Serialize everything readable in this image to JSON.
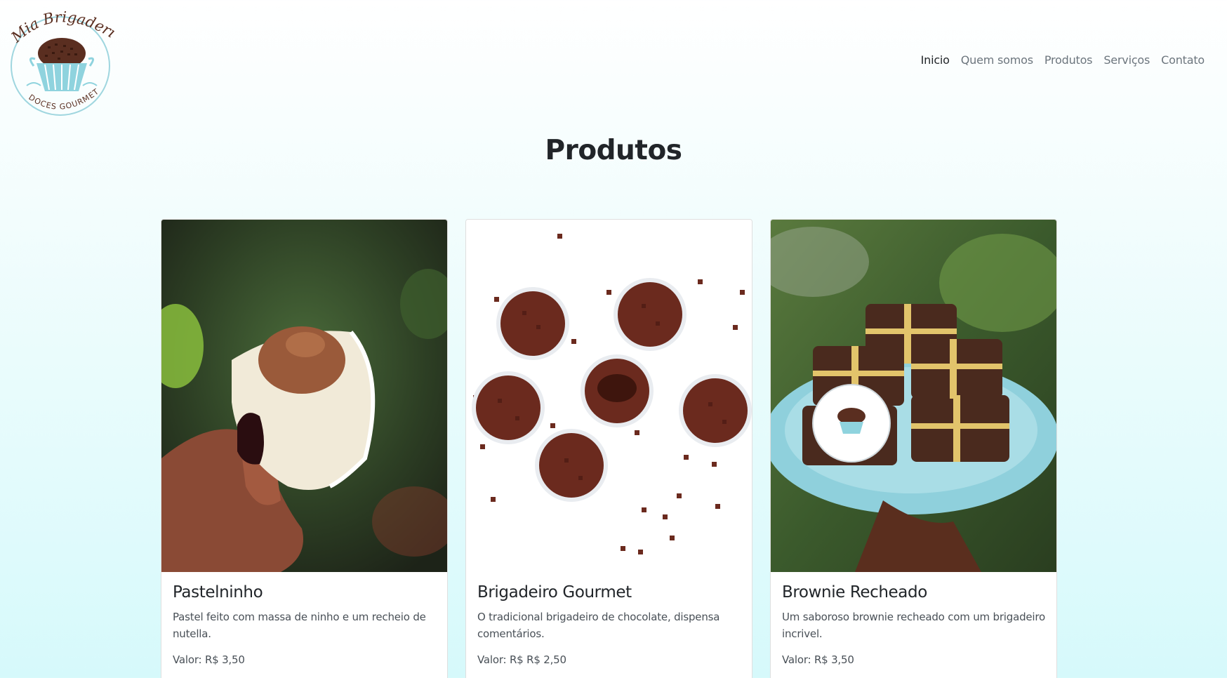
{
  "logo": {
    "script_text": "Mia Brigaderia",
    "tagline": "DOCES GOURMET"
  },
  "nav": {
    "items": [
      {
        "label": "Inicio"
      },
      {
        "label": "Quem somos"
      },
      {
        "label": "Produtos"
      },
      {
        "label": "Serviços"
      },
      {
        "label": "Contato"
      }
    ]
  },
  "page": {
    "title": "Produtos"
  },
  "products": [
    {
      "title": "Pastelninho",
      "description": "Pastel feito com massa de ninho e um recheio de nutella.",
      "price": "Valor: R$ 3,50",
      "image": "pastel-photo"
    },
    {
      "title": "Brigadeiro Gourmet",
      "description": "O tradicional brigadeiro de chocolate, dispensa comentários.",
      "price": "Valor: R$ R$ 2,50",
      "image": "brigadeiro-photo"
    },
    {
      "title": "Brownie Recheado",
      "description": "Um saboroso brownie recheado com um brigadeiro incrivel.",
      "price": "Valor: R$ 3,50",
      "image": "brownie-photo"
    }
  ],
  "colors": {
    "accent_light_blue": "#8fd3de",
    "chocolate": "#5a2e20",
    "text_dark": "#212529",
    "text_muted": "#6c757d"
  }
}
